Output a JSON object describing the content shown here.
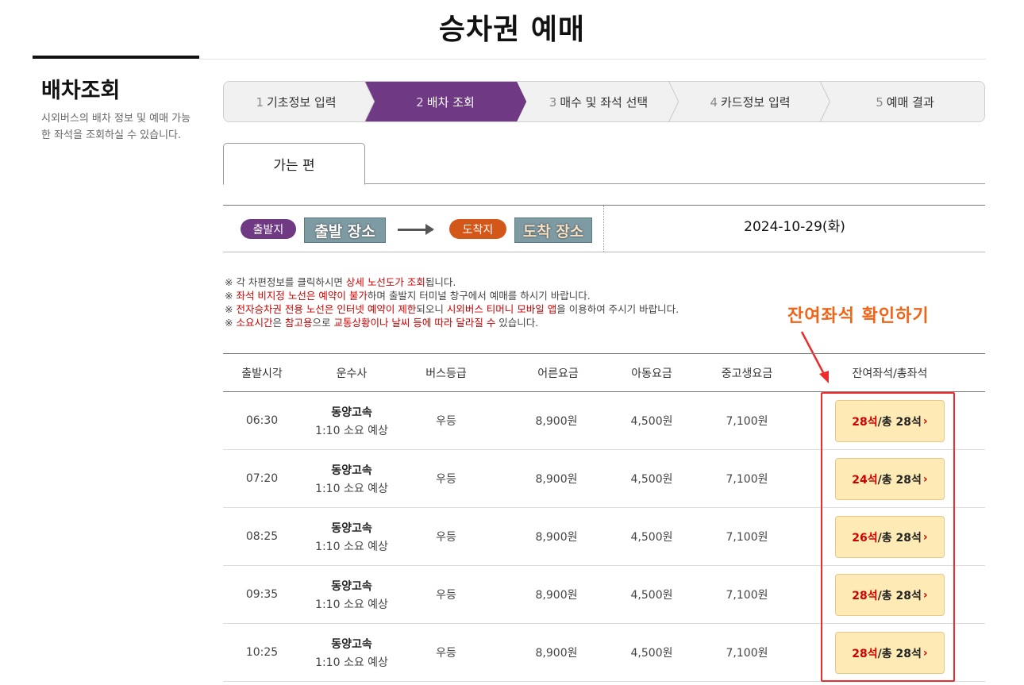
{
  "page_title": "승차권 예매",
  "side": {
    "title": "배차조회",
    "description": "시외버스의 배차 정보 및 예매 가능한 좌석을 조회하실 수 있습니다."
  },
  "steps": [
    {
      "num": "1",
      "label": "기초정보 입력"
    },
    {
      "num": "2",
      "label": "배차 조회"
    },
    {
      "num": "3",
      "label": "매수 및 좌석 선택"
    },
    {
      "num": "4",
      "label": "카드정보 입력"
    },
    {
      "num": "5",
      "label": "예매 결과"
    }
  ],
  "active_step": 2,
  "colors": {
    "active_step": "#6f3a83",
    "departure_badge": "#6f3a83",
    "arrival_badge": "#d4571a",
    "seat_button": "#fdeab4",
    "highlight": "#ef2a2a"
  },
  "tab": {
    "label": "가는 편"
  },
  "route": {
    "departure_badge": "출발지",
    "departure_place": "출발 장소",
    "arrival_badge": "도착지",
    "arrival_place": "도착 장소",
    "date": "2024-10-29(화)"
  },
  "notes": {
    "n1_a": "※ 각 차편정보를 클릭하시면 ",
    "n1_b": "상세 노선도가 조회",
    "n1_c": "됩니다.",
    "n2_a": "※ ",
    "n2_b": "좌석 비지정 노선은 예약이 불가",
    "n2_c": "하며 출발지 터미널 창구에서 예매를 하시기 바랍니다.",
    "n3_a": "※ ",
    "n3_b": "전자승차권 전용 노선은 인터넷 예약이 제한",
    "n3_c": "되오니 ",
    "n3_d": "시외버스 티머니 모바일 앱",
    "n3_e": "을 이용하여 주시기 바랍니다.",
    "n4_a": "※ ",
    "n4_b": "소요시간",
    "n4_c": "은 ",
    "n4_d": "참고용",
    "n4_e": "으로 ",
    "n4_f": "교통상황이나 날씨 등에 따라 달라질 수",
    "n4_g": " 있습니다."
  },
  "annotation": "잔여좌석 확인하기",
  "table": {
    "headers": [
      "출발시각",
      "운수사",
      "버스등급",
      "어른요금",
      "아동요금",
      "중고생요금",
      "잔여좌석/총좌석"
    ],
    "rows": [
      {
        "time": "06:30",
        "company": "동양고속",
        "duration": "1:10 소요 예상",
        "grade": "우등",
        "adult": "8,900원",
        "child": "4,500원",
        "student": "7,100원",
        "remain": "28석",
        "total": " /총 28석"
      },
      {
        "time": "07:20",
        "company": "동양고속",
        "duration": "1:10 소요 예상",
        "grade": "우등",
        "adult": "8,900원",
        "child": "4,500원",
        "student": "7,100원",
        "remain": "24석",
        "total": " /총 28석"
      },
      {
        "time": "08:25",
        "company": "동양고속",
        "duration": "1:10 소요 예상",
        "grade": "우등",
        "adult": "8,900원",
        "child": "4,500원",
        "student": "7,100원",
        "remain": "26석",
        "total": " /총 28석"
      },
      {
        "time": "09:35",
        "company": "동양고속",
        "duration": "1:10 소요 예상",
        "grade": "우등",
        "adult": "8,900원",
        "child": "4,500원",
        "student": "7,100원",
        "remain": "28석",
        "total": " /총 28석"
      },
      {
        "time": "10:25",
        "company": "동양고속",
        "duration": "1:10 소요 예상",
        "grade": "우등",
        "adult": "8,900원",
        "child": "4,500원",
        "student": "7,100원",
        "remain": "28석",
        "total": " /총 28석"
      }
    ],
    "chevron": "›"
  }
}
